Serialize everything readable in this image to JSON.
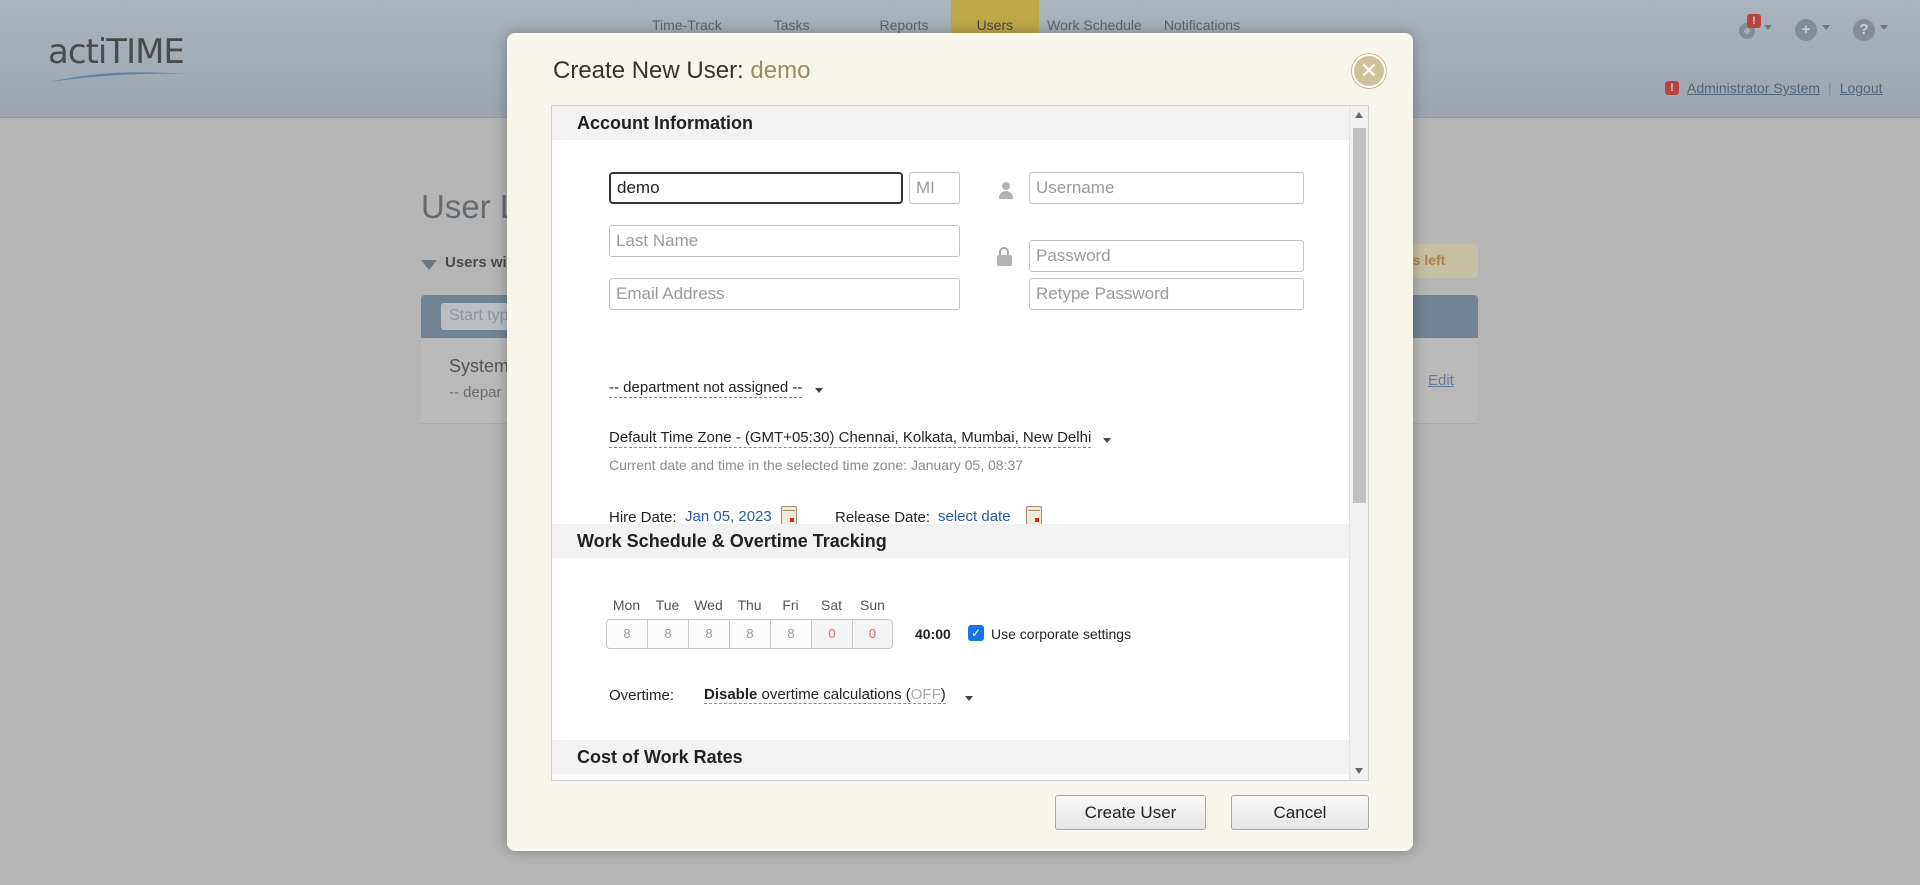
{
  "app": {
    "logo": "actiTIME",
    "nav": [
      "Time-Track",
      "Tasks",
      "Reports",
      "Users",
      "Work Schedule",
      "Notifications"
    ],
    "active_nav": "Users",
    "user_name": "Administrator System",
    "logout": "Logout",
    "badge": "!",
    "add_icon_glyph": "+",
    "help_icon_glyph": "?"
  },
  "background": {
    "page_title": "User L",
    "filter_label": "Users wi",
    "seats": "ts left",
    "search_placeholder": "Start typ",
    "row_name": "System",
    "row_dept": "-- depar",
    "row_edit": "Edit"
  },
  "modal": {
    "title": "Create New User:",
    "title_name": "demo",
    "close_glyph": "✕",
    "account_section": "Account Information",
    "first_name_value": "demo",
    "mi_placeholder": "MI",
    "username_placeholder": "Username",
    "last_name_placeholder": "Last Name",
    "password_placeholder": "Password",
    "email_placeholder": "Email Address",
    "retype_password_placeholder": "Retype Password",
    "department": "-- department not assigned --",
    "timezone": "Default Time Zone - (GMT+05:30) Chennai, Kolkata, Mumbai, New Delhi",
    "timezone_hint": "Current date and time in the selected time zone: January 05, 08:37",
    "hire_date_label": "Hire Date:",
    "hire_date_value": "Jan 05, 2023",
    "release_date_label": "Release Date:",
    "release_date_value": "select date",
    "schedule_section": "Work Schedule & Overtime Tracking",
    "days": [
      {
        "name": "Mon",
        "hours": "8"
      },
      {
        "name": "Tue",
        "hours": "8"
      },
      {
        "name": "Wed",
        "hours": "8"
      },
      {
        "name": "Thu",
        "hours": "8"
      },
      {
        "name": "Fri",
        "hours": "8"
      },
      {
        "name": "Sat",
        "hours": "0"
      },
      {
        "name": "Sun",
        "hours": "0"
      }
    ],
    "total_hours": "40:00",
    "check_glyph": "✓",
    "corporate_settings_label": "Use corporate settings",
    "overtime_label": "Overtime:",
    "overtime_bold": "Disable",
    "overtime_text": "overtime calculations (",
    "overtime_off": "OFF",
    "overtime_close": ")",
    "cost_section": "Cost of Work Rates",
    "create_button": "Create User",
    "cancel_button": "Cancel"
  }
}
